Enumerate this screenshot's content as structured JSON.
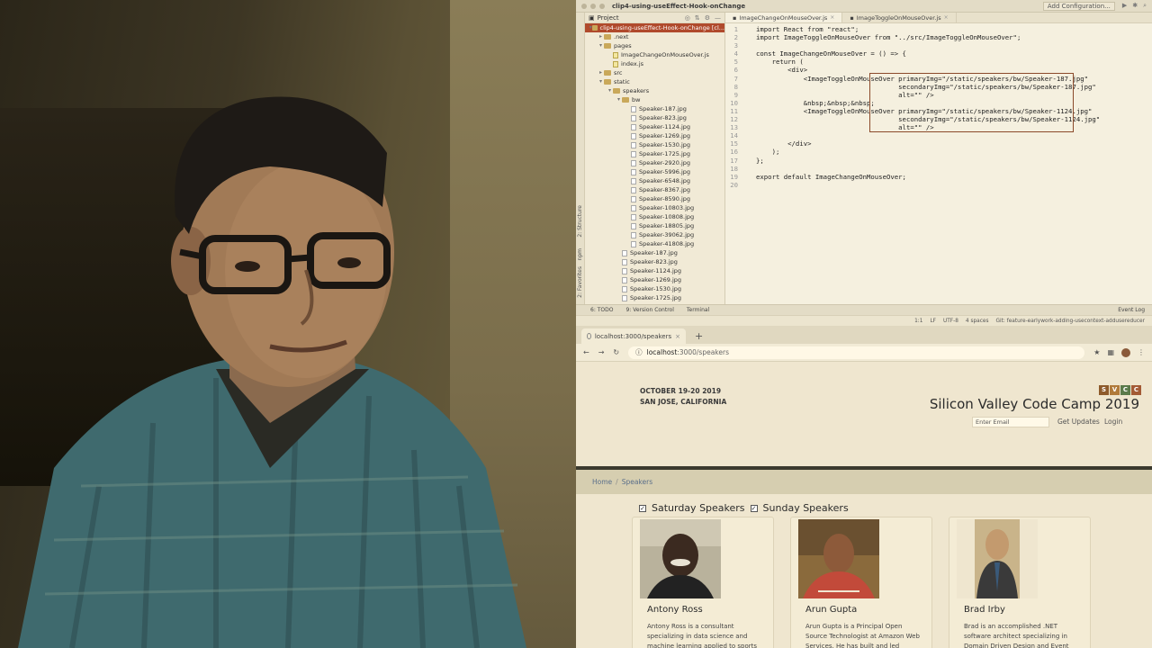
{
  "ide": {
    "project_name": "clip4-using-useEffect-Hook-onChange",
    "run_config": "Add Configuration...",
    "project_label": "Project",
    "tree": [
      {
        "label": "clip4-using-useEffect-Hook-onChange [cl...",
        "kind": "folder",
        "indent": 0,
        "open": true,
        "selected": true
      },
      {
        "label": ".next",
        "kind": "folder",
        "indent": 1,
        "open": false
      },
      {
        "label": "pages",
        "kind": "folder",
        "indent": 1,
        "open": true
      },
      {
        "label": "ImageChangeOnMouseOver.js",
        "kind": "js",
        "indent": 2
      },
      {
        "label": "index.js",
        "kind": "js",
        "indent": 2
      },
      {
        "label": "src",
        "kind": "folder",
        "indent": 1,
        "open": false
      },
      {
        "label": "static",
        "kind": "folder",
        "indent": 1,
        "open": true
      },
      {
        "label": "speakers",
        "kind": "folder",
        "indent": 2,
        "open": true
      },
      {
        "label": "bw",
        "kind": "folder",
        "indent": 3,
        "open": true
      },
      {
        "label": "Speaker-187.jpg",
        "kind": "file",
        "indent": 4
      },
      {
        "label": "Speaker-823.jpg",
        "kind": "file",
        "indent": 4
      },
      {
        "label": "Speaker-1124.jpg",
        "kind": "file",
        "indent": 4
      },
      {
        "label": "Speaker-1269.jpg",
        "kind": "file",
        "indent": 4
      },
      {
        "label": "Speaker-1530.jpg",
        "kind": "file",
        "indent": 4
      },
      {
        "label": "Speaker-1725.jpg",
        "kind": "file",
        "indent": 4
      },
      {
        "label": "Speaker-2920.jpg",
        "kind": "file",
        "indent": 4
      },
      {
        "label": "Speaker-5996.jpg",
        "kind": "file",
        "indent": 4
      },
      {
        "label": "Speaker-6548.jpg",
        "kind": "file",
        "indent": 4
      },
      {
        "label": "Speaker-8367.jpg",
        "kind": "file",
        "indent": 4
      },
      {
        "label": "Speaker-8590.jpg",
        "kind": "file",
        "indent": 4
      },
      {
        "label": "Speaker-10803.jpg",
        "kind": "file",
        "indent": 4
      },
      {
        "label": "Speaker-10808.jpg",
        "kind": "file",
        "indent": 4
      },
      {
        "label": "Speaker-18805.jpg",
        "kind": "file",
        "indent": 4
      },
      {
        "label": "Speaker-39062.jpg",
        "kind": "file",
        "indent": 4
      },
      {
        "label": "Speaker-41808.jpg",
        "kind": "file",
        "indent": 4
      },
      {
        "label": "Speaker-187.jpg",
        "kind": "file",
        "indent": 3
      },
      {
        "label": "Speaker-823.jpg",
        "kind": "file",
        "indent": 3
      },
      {
        "label": "Speaker-1124.jpg",
        "kind": "file",
        "indent": 3
      },
      {
        "label": "Speaker-1269.jpg",
        "kind": "file",
        "indent": 3
      },
      {
        "label": "Speaker-1530.jpg",
        "kind": "file",
        "indent": 3
      },
      {
        "label": "Speaker-1725.jpg",
        "kind": "file",
        "indent": 3
      }
    ],
    "tabs": [
      {
        "label": "ImageChangeOnMouseOver.js",
        "active": true
      },
      {
        "label": "ImageToggleOnMouseOver.js",
        "active": false
      }
    ],
    "code_lines": [
      "import React from \"react\";",
      "import ImageToggleOnMouseOver from \"../src/ImageToggleOnMouseOver\";",
      "",
      "const ImageChangeOnMouseOver = () => {",
      "    return (",
      "        <div>",
      "            <ImageToggleOnMouseOver primaryImg=\"/static/speakers/bw/Speaker-187.jpg\"",
      "                                    secondaryImg=\"/static/speakers/bw/Speaker-187.jpg\"",
      "                                    alt=\"\" />",
      "            &nbsp;&nbsp;&nbsp;",
      "            <ImageToggleOnMouseOver primaryImg=\"/static/speakers/bw/Speaker-1124.jpg\"",
      "                                    secondaryImg=\"/static/speakers/bw/Speaker-1124.jpg\"",
      "                                    alt=\"\" />",
      "",
      "        </div>",
      "    );",
      "};",
      "",
      "export default ImageChangeOnMouseOver;",
      ""
    ],
    "side_tools": [
      "2: Structure",
      "npm",
      "2: Favorites"
    ],
    "bottom_tools": [
      "6: TODO",
      "9: Version Control",
      "Terminal"
    ],
    "event_log": "Event Log",
    "status": [
      "1:1",
      "LF",
      "UTF-8",
      "4 spaces",
      "Git: feature-earlywork-adding-usecontext-addusereducer"
    ]
  },
  "browser": {
    "tab_title": "localhost:3000/speakers",
    "url_host": "localhost",
    "url_path": ":3000/speakers",
    "new_tab": "+"
  },
  "site": {
    "date_line": "OCTOBER 19-20  2019",
    "location_line": "SAN JOSE, CALIFORNIA",
    "logo_letters": [
      "S",
      "V",
      "C",
      "C"
    ],
    "logo_colors": [
      "#8d5a2b",
      "#b07a3a",
      "#5a7a4a",
      "#a35a35"
    ],
    "title": "Silicon Valley Code Camp 2019",
    "email_placeholder": "Enter Email",
    "get_updates": "Get Updates",
    "login": "Login",
    "breadcrumbs": [
      "Home",
      "Speakers"
    ],
    "filters": [
      {
        "label": "Saturday Speakers",
        "checked": true
      },
      {
        "label": "Sunday Speakers",
        "checked": true
      }
    ],
    "speakers": [
      {
        "name": "Antony Ross",
        "bio": "Antony Ross is a consultant specializing in data science and machine learning applied to sports"
      },
      {
        "name": "Arun Gupta",
        "bio": "Arun Gupta is a Principal Open Source Technologist at Amazon Web Services. He has built and led developer"
      },
      {
        "name": "Brad Irby",
        "bio": "Brad is an accomplished .NET software architect specializing in Domain Driven Design and Event Driven Architecture"
      }
    ]
  }
}
